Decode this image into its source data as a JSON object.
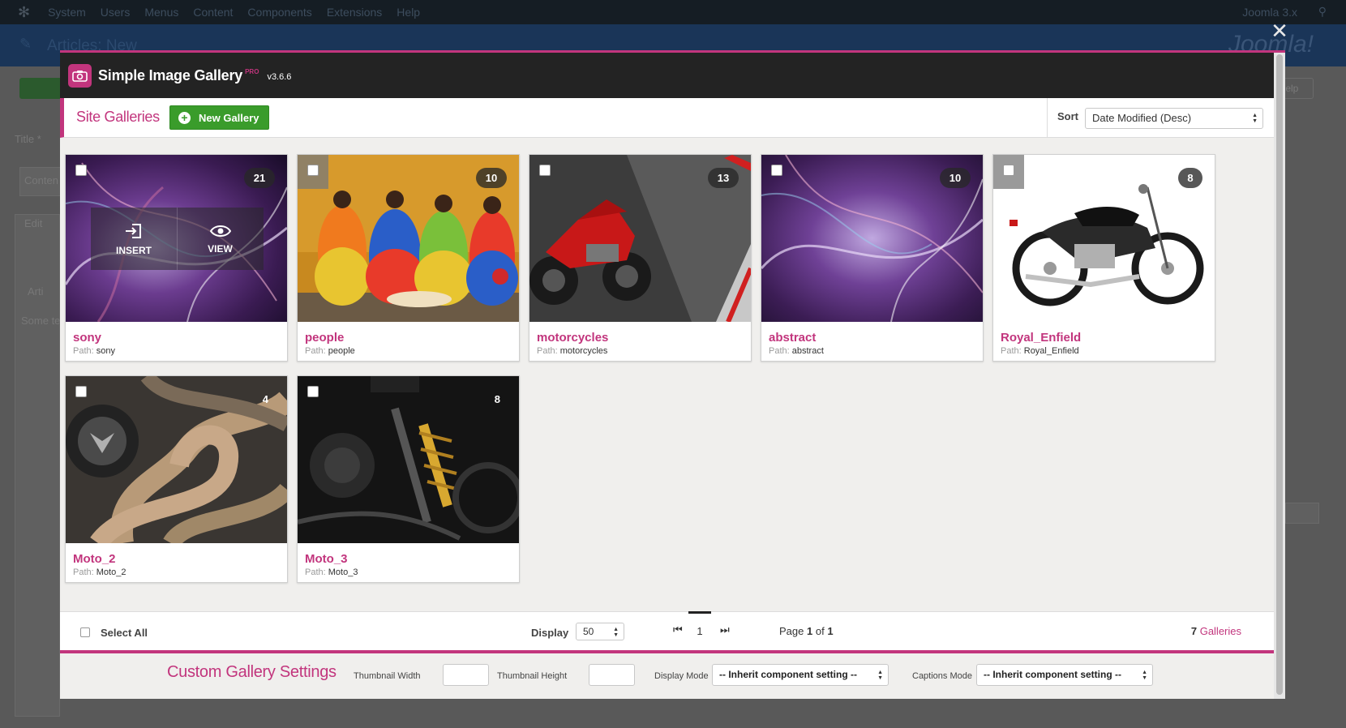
{
  "backdrop": {
    "menu": [
      "System",
      "Users",
      "Menus",
      "Content",
      "Components",
      "Extensions",
      "Help"
    ],
    "joomla_version": "Joomla 3.x",
    "page_title": "Articles: New",
    "help_label": "Help",
    "labels": {
      "title": "Title *",
      "content": "Conten",
      "edit": "Edit",
      "some_text": "Some te",
      "article": "Arti"
    }
  },
  "app": {
    "title": "Simple Image Gallery",
    "pro": "PRO",
    "version": "v3.6.6"
  },
  "toolbar": {
    "section_title": "Site Galleries",
    "new_gallery_label": "New Gallery",
    "sort_label": "Sort",
    "sort_value": "Date Modified (Desc)"
  },
  "galleries": [
    {
      "name": "sony",
      "path_label": "Path:",
      "path": "sony",
      "count": "21",
      "thumb": "abstract-purple"
    },
    {
      "name": "people",
      "path_label": "Path:",
      "path": "people",
      "count": "10",
      "thumb": "colorful-dresses"
    },
    {
      "name": "motorcycles",
      "path_label": "Path:",
      "path": "motorcycles",
      "count": "13",
      "thumb": "red-sportbike"
    },
    {
      "name": "abstract",
      "path_label": "Path:",
      "path": "abstract",
      "count": "10",
      "thumb": "abstract-purple"
    },
    {
      "name": "Royal_Enfield",
      "path_label": "Path:",
      "path": "Royal_Enfield",
      "count": "8",
      "thumb": "black-classic-motorcycle"
    },
    {
      "name": "Moto_2",
      "path_label": "Path:",
      "path": "Moto_2",
      "count": "4",
      "thumb": "exhaust-pipes"
    },
    {
      "name": "Moto_3",
      "path_label": "Path:",
      "path": "Moto_3",
      "count": "8",
      "thumb": "dark-motorcycle-detail"
    }
  ],
  "hover": {
    "insert_label": "INSERT",
    "view_label": "VIEW"
  },
  "footer": {
    "select_all_label": "Select All",
    "display_label": "Display",
    "display_value": "50",
    "current_page": "1",
    "page_prefix": "Page",
    "page_current": "1",
    "page_of": "of",
    "page_total": "1",
    "gallery_count": "7",
    "gallery_count_label": "Galleries"
  },
  "settings": {
    "title": "Custom Gallery Settings",
    "thumb_width_label": "Thumbnail Width",
    "thumb_width_value": "",
    "thumb_height_label": "Thumbnail Height",
    "thumb_height_value": "",
    "display_mode_label": "Display Mode",
    "display_mode_value": "-- Inherit component setting --",
    "captions_mode_label": "Captions Mode",
    "captions_mode_value": "-- Inherit component setting --"
  },
  "colors": {
    "accent": "#c2357d",
    "header_bg": "#232323",
    "new_gallery_green": "#3a9c2b"
  }
}
